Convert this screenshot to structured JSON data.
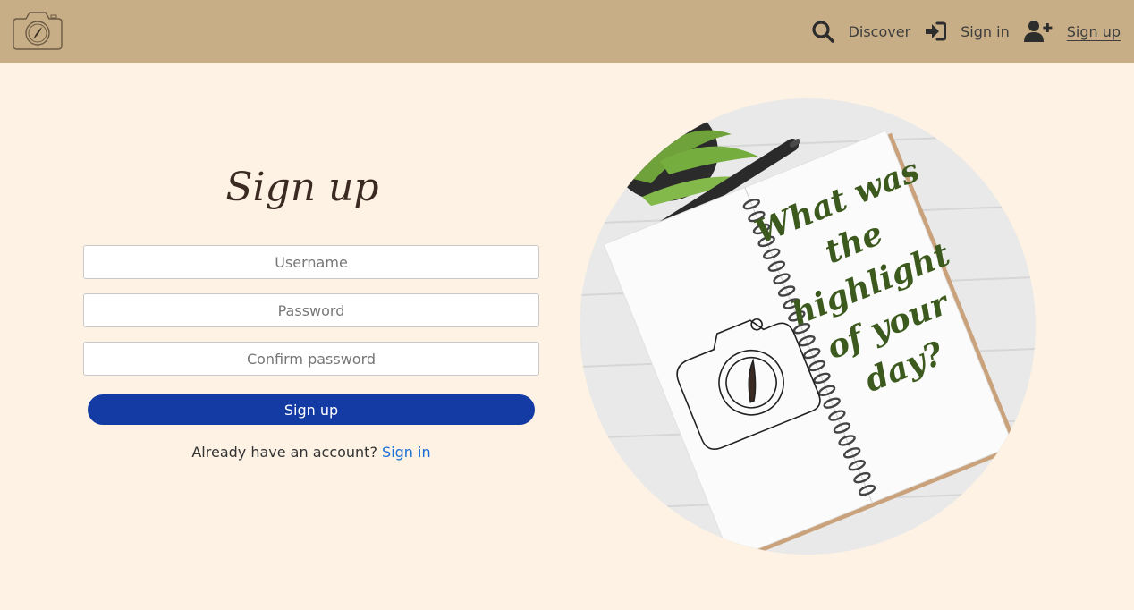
{
  "navbar": {
    "logo_icon": "camera-feather-icon",
    "items": [
      {
        "label": "Discover",
        "icon": "search-icon"
      },
      {
        "label": "Sign in",
        "icon": "sign-in-icon"
      },
      {
        "label": "Sign up",
        "icon": "user-plus-icon",
        "active": true
      }
    ]
  },
  "form": {
    "title": "Sign up",
    "username_placeholder": "Username",
    "password_placeholder": "Password",
    "confirm_placeholder": "Confirm password",
    "submit_label": "Sign up",
    "already_text": "Already have an account?",
    "signin_link": "Sign in"
  },
  "hero": {
    "handwriting": [
      "What was",
      "the",
      "highlight",
      "of your",
      "day?"
    ]
  },
  "colors": {
    "navbar": "#c8ae86",
    "background": "#fdf2e3",
    "primary_button": "#133ba3",
    "link": "#1a6fd6",
    "handwriting": "#3d5a1e"
  }
}
